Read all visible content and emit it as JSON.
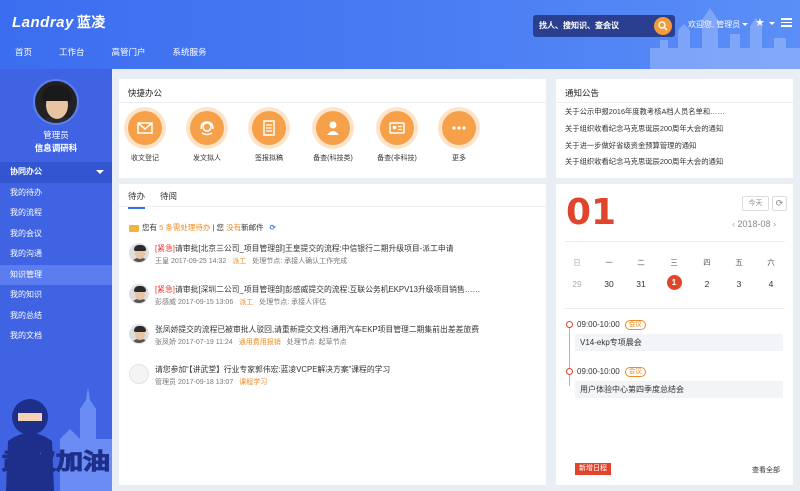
{
  "header": {
    "logo_en": "Landray",
    "logo_cn": "蓝凌",
    "nav": [
      "首页",
      "工作台",
      "高管门户",
      "系统服务"
    ],
    "search_placeholder": "找人、搜知识、查会议",
    "welcome": "欢迎您,",
    "username": "管理员",
    "star_icon": "star-icon",
    "menu_icon": "hamburger-icon"
  },
  "sidebar": {
    "user_name": "管理员",
    "user_dept": "信息调研科",
    "groups": [
      {
        "label": "协同办公",
        "items": [
          "我的待办",
          "我的流程",
          "我的会议",
          "我的沟通"
        ]
      },
      {
        "label": "知识管理",
        "items": [
          "我的知识",
          "我的总结",
          "我的文档"
        ]
      }
    ],
    "mascot_text": "武汉加油"
  },
  "quick_office": {
    "title": "快捷办公",
    "items": [
      {
        "label": "收文登记",
        "icon": "envelope-icon"
      },
      {
        "label": "发文拟人",
        "icon": "headset-icon"
      },
      {
        "label": "签报拟稿",
        "icon": "document-icon"
      },
      {
        "label": "备查(科技类)",
        "icon": "person-icon"
      },
      {
        "label": "备查(非科技)",
        "icon": "id-card-icon"
      },
      {
        "label": "更多",
        "icon": "more-icon"
      }
    ],
    "accent": "#f6a14a"
  },
  "notices": {
    "title": "通知公告",
    "items": [
      "关于公示申报2016年度教考核A档人员名单和……",
      "关于组织收看纪念马克思诞辰200周年大会的通知",
      "关于进一步做好省级资金预算管理的通知",
      "关于组织收看纪念马克思诞辰200周年大会的通知"
    ]
  },
  "todo": {
    "tabs": [
      "待办",
      "待阅"
    ],
    "summary": {
      "pre": "您有",
      "count": "5",
      "link": "条需处理待办",
      "mid": "您",
      "none": "没有",
      "post": "新邮件"
    },
    "items": [
      {
        "urgent": "[紧急]",
        "title": "请审批[北京三公司_项目管理部]王皇提交的流程:中信银行二期升级项目-派工申请",
        "person": "王皇",
        "time": "2017-09-25 14:32",
        "tag": "派工",
        "node": "处理节点: 承接人确认工作完成"
      },
      {
        "urgent": "[紧急]",
        "title": "请审批[深圳二公司_项目管理部]彭感威提交的流程:互联公务机EKPV13升级项目销售……",
        "person": "彭感威",
        "time": "2017-09-15 13:06",
        "tag": "派工",
        "node": "处理节点: 承接人评估"
      },
      {
        "urgent": "",
        "title": "张凤娇提交的流程已被审批人驳回,请重新提交文档:通用汽车EKP项目管理二期集前出差差旅费",
        "person": "张凤娇",
        "time": "2017-07-19 11:24",
        "tag": "通用费用报销",
        "node": "处理节点: 起草节点"
      },
      {
        "urgent": "",
        "title": "请您参加“【讲武堂】行业专家郭伟宏:蓝凌VCPE解决方案”课程的学习",
        "person": "管理员",
        "time": "2017-09-18 13:07",
        "tag": "课程学习",
        "node": ""
      }
    ]
  },
  "calendar": {
    "day": "01",
    "today_label": "今天",
    "refresh_icon": "refresh-icon",
    "month": "2018-08",
    "weekdays": [
      "日",
      "一",
      "二",
      "三",
      "四",
      "五",
      "六"
    ],
    "dates": [
      "29",
      "30",
      "31",
      "1",
      "2",
      "3",
      "4"
    ],
    "selected_index": 3,
    "events": [
      {
        "time": "09:00-10:00",
        "tag": "会议",
        "title": "V14-ekp专项晨会"
      },
      {
        "time": "09:00-10:00",
        "tag": "会议",
        "title": "用户体验中心第四季度总结会"
      }
    ],
    "new_label": "新增日程",
    "view_all": "查看全部",
    "accent": "#e0452c"
  }
}
